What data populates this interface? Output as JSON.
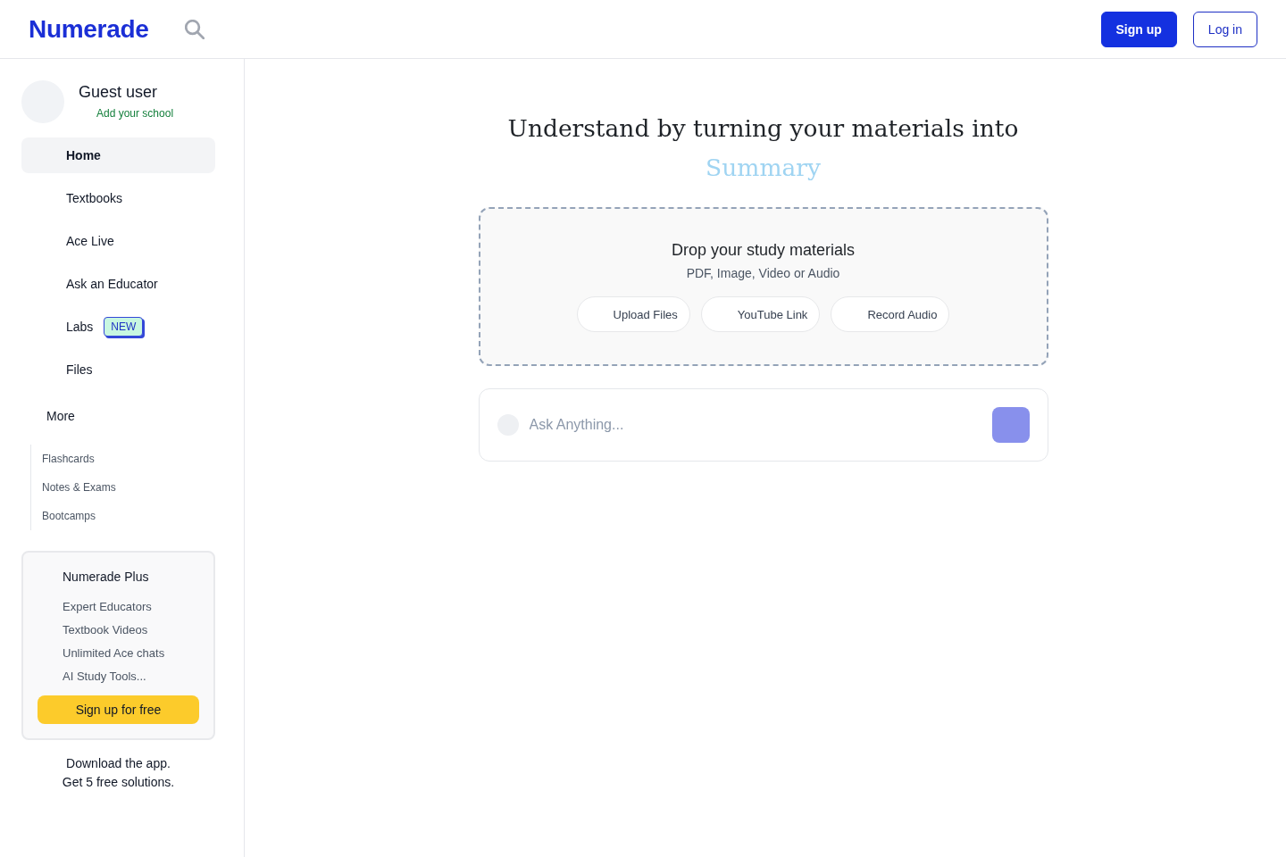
{
  "header": {
    "logo": "Numerade",
    "buttons": [
      {
        "label": "Sign up",
        "kind": "primary"
      },
      {
        "label": "Log in",
        "kind": "outline"
      }
    ]
  },
  "sidebar": {
    "user": {
      "name": "Guest user",
      "school_link": "Add your school"
    },
    "nav": [
      {
        "label": "Home",
        "selected": true
      },
      {
        "label": "Textbooks",
        "selected": false
      },
      {
        "label": "Ace Live",
        "selected": false
      },
      {
        "label": "Ask an Educator",
        "selected": false
      },
      {
        "label": "Labs",
        "selected": false,
        "badge": "NEW"
      },
      {
        "label": "Files",
        "selected": false
      }
    ],
    "more": {
      "label": "More",
      "items": [
        "Flashcards",
        "Notes & Exams",
        "Bootcamps"
      ]
    },
    "plus_card": {
      "title": "Numerade Plus",
      "features": [
        "Expert Educators",
        "Textbook Videos",
        "Unlimited Ace chats",
        "AI Study Tools..."
      ],
      "button": "Sign up for free"
    },
    "app_promo": [
      "Download the app.",
      "Get 5 free solutions."
    ]
  },
  "main": {
    "heading": "Understand by turning your materials into",
    "highlight": "Summary",
    "dropzone": {
      "title": "Drop your study materials",
      "subtitle": "PDF, Image, Video or Audio",
      "buttons": [
        "Upload Files",
        "YouTube Link",
        "Record Audio"
      ]
    },
    "ask": {
      "placeholder": "Ask Anything..."
    }
  }
}
